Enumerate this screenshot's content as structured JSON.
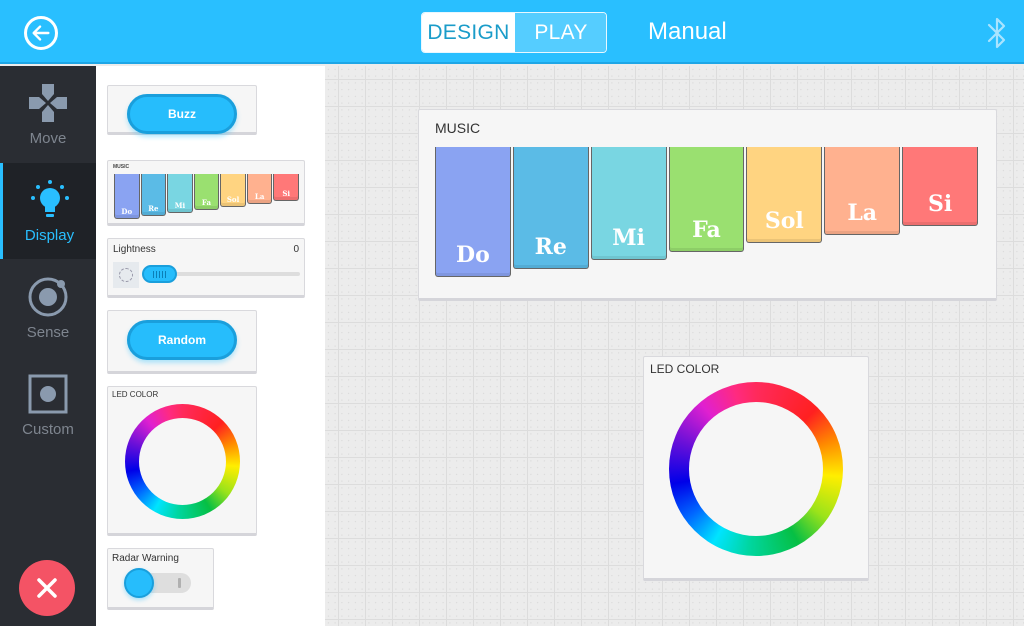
{
  "header": {
    "back_icon": "arrow-left-circle-icon",
    "mode_tabs": [
      {
        "label": "DESIGN",
        "active": true
      },
      {
        "label": "PLAY",
        "active": false
      }
    ],
    "title": "Manual",
    "bluetooth_icon": "bluetooth-icon"
  },
  "sidebar": {
    "items": [
      {
        "label": "Move",
        "icon": "dpad-icon",
        "active": false
      },
      {
        "label": "Display",
        "icon": "lightbulb-icon",
        "active": true
      },
      {
        "label": "Sense",
        "icon": "sensor-ring-icon",
        "active": false
      },
      {
        "label": "Custom",
        "icon": "square-dot-icon",
        "active": false
      }
    ],
    "close_icon": "close-icon",
    "colors": {
      "accent": "#29bfff",
      "close": "#f45365",
      "background": "#2a2d33"
    }
  },
  "palette": {
    "buzz_label": "Buzz",
    "music": {
      "title": "MUSIC",
      "keys": [
        "Do",
        "Re",
        "Mi",
        "Fa",
        "Sol",
        "La",
        "Si"
      ]
    },
    "lightness": {
      "label": "Lightness",
      "value": "0",
      "slider_fraction": 0
    },
    "random_label": "Random",
    "led_color_title": "LED COLOR",
    "radar": {
      "label": "Radar Warning",
      "on": false
    }
  },
  "canvas": {
    "music": {
      "title": "MUSIC",
      "keys": [
        {
          "label": "Do",
          "color": "#8aa3f2"
        },
        {
          "label": "Re",
          "color": "#5bbbe6"
        },
        {
          "label": "Mi",
          "color": "#79d6e2"
        },
        {
          "label": "Fa",
          "color": "#9ae070"
        },
        {
          "label": "Sol",
          "color": "#ffd481"
        },
        {
          "label": "La",
          "color": "#ffb18f"
        },
        {
          "label": "Si",
          "color": "#ff7878"
        }
      ]
    },
    "led_color_title": "LED COLOR"
  }
}
